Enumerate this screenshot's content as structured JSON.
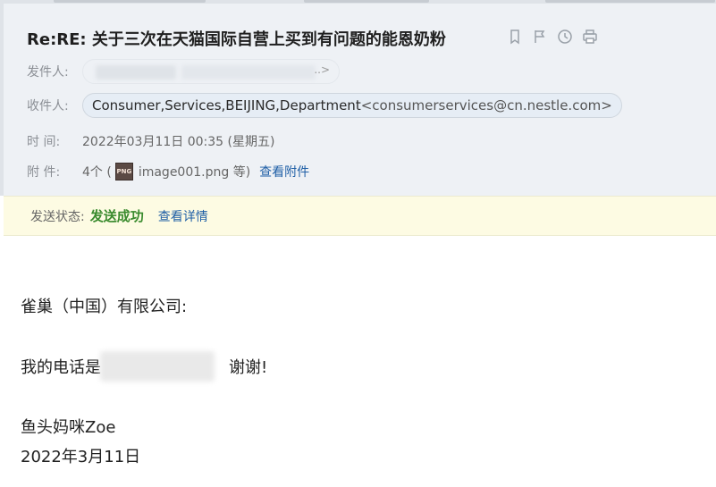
{
  "email": {
    "subject": "Re:RE: 关于三次在天猫国际自营上买到有问题的能恩奶粉",
    "from_label": "发件人:",
    "to_label": "收件人:",
    "to_name": "Consumer,Services,BEIJING,Department",
    "to_address": "<consumerservices@cn.nestle.com>",
    "time_label": "时   间:",
    "time_value": "2022年03月11日 00:35 (星期五)",
    "attach_label": "附   件:",
    "attach_count": "4个 (",
    "attach_icon_text": "PNG",
    "attach_file": "image001.png 等)",
    "attach_link": "查看附件",
    "from_suffix": "..>"
  },
  "status": {
    "label": "发送状态:",
    "value": "发送成功",
    "detail_link": "查看详情"
  },
  "body": {
    "greeting": "雀巢（中国）有限公司:",
    "phone_prefix": "我的电话是",
    "phone_suffix": "谢谢!",
    "signature": "鱼头妈咪Zoe",
    "date": "2022年3月11日"
  },
  "icons": [
    "bookmark-icon",
    "flag-icon",
    "clock-icon",
    "print-icon",
    "png-file-icon"
  ],
  "colors": {
    "header_bg": "#eef1f5",
    "status_bg": "#fdfbe3",
    "success": "#3a8b2e",
    "link": "#1f5fa6"
  }
}
